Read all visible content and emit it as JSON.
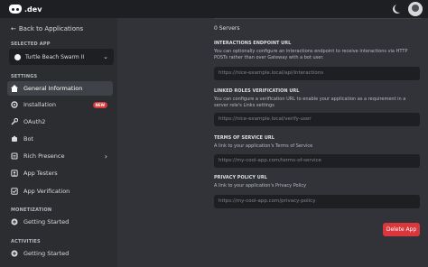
{
  "header": {
    "logo_text": ".dev",
    "theme_icon": "moon-icon",
    "avatar_icon": "avatar"
  },
  "sidebar": {
    "back_label": "Back to Applications",
    "selected_app_label": "SELECTED APP",
    "selected_app_name": "Turtle Beach Swarm II",
    "settings_label": "SETTINGS",
    "settings_items": [
      {
        "label": "General Information",
        "icon": "home-icon",
        "active": true
      },
      {
        "label": "Installation",
        "icon": "gear-icon",
        "badge": "NEW"
      },
      {
        "label": "OAuth2",
        "icon": "wrench-icon"
      },
      {
        "label": "Bot",
        "icon": "puzzle-icon"
      },
      {
        "label": "Rich Presence",
        "icon": "document-icon",
        "chevron": true
      },
      {
        "label": "App Testers",
        "icon": "user-icon"
      },
      {
        "label": "App Verification",
        "icon": "check-icon"
      }
    ],
    "monetization_label": "MONETIZATION",
    "monetization_items": [
      {
        "label": "Getting Started",
        "icon": "plus-icon"
      }
    ],
    "activities_label": "ACTIVITIES",
    "activities_items": [
      {
        "label": "Getting Started",
        "icon": "plus-icon"
      }
    ]
  },
  "main": {
    "servers_text": "0 Servers",
    "interactions": {
      "title": "INTERACTIONS ENDPOINT URL",
      "desc": "You can optionally configure an interactions endpoint to receive interactions via HTTP POSTs rather than over Gateway with a bot user.",
      "placeholder": "https://nice-example.local/api/interactions"
    },
    "linked_roles": {
      "title": "LINKED ROLES VERIFICATION URL",
      "desc": "You can configure a verification URL to enable your application as a requirement in a server role's Links settings",
      "placeholder": "https://nice-example.local/verify-user"
    },
    "terms": {
      "title": "TERMS OF SERVICE URL",
      "desc": "A link to your application's Terms of Service",
      "placeholder": "https://my-cool-app.com/terms-of-service"
    },
    "privacy": {
      "title": "PRIVACY POLICY URL",
      "desc": "A link to your application's Privacy Policy",
      "placeholder": "https://my-cool-app.com/privacy-policy"
    },
    "delete_label": "Delete App"
  },
  "colors": {
    "accent_danger": "#da373c",
    "active_nav": "#404249"
  }
}
